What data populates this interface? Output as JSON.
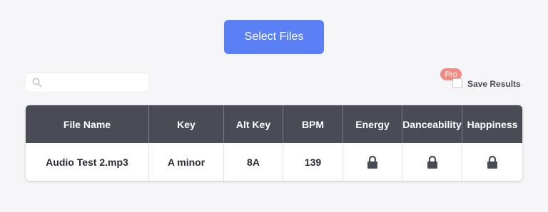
{
  "select_files_label": "Select Files",
  "search": {
    "value": "",
    "placeholder": ""
  },
  "pro_badge": "Pro",
  "save_results_label": "Save Results",
  "table": {
    "headers": [
      "File Name",
      "Key",
      "Alt Key",
      "BPM",
      "Energy",
      "Danceability",
      "Happiness"
    ],
    "rows": [
      {
        "file_name": "Audio Test 2.mp3",
        "key": "A minor",
        "alt_key": "8A",
        "bpm": "139",
        "energy": "lock-icon",
        "danceability": "lock-icon",
        "happiness": "lock-icon"
      }
    ]
  },
  "colors": {
    "background": "#f6f6f9",
    "accent": "#5b80f6",
    "pro_badge": "#f08c84",
    "table_header": "#4a4c55"
  }
}
